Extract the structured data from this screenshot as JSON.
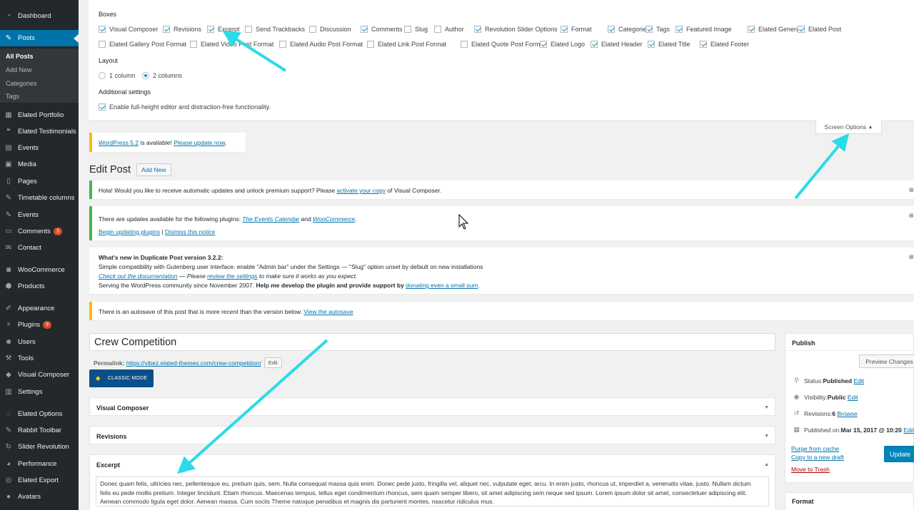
{
  "sidebar": {
    "items": [
      {
        "label": "Dashboard",
        "icon": "dashboard-icon",
        "glyph": "◔"
      },
      {
        "label": "Posts",
        "icon": "pushpin-icon",
        "glyph": "✎",
        "active": true
      },
      {
        "label": "Elated Portfolio",
        "icon": "grid-icon",
        "glyph": "▦"
      },
      {
        "label": "Elated Testimonials",
        "icon": "quote-icon",
        "glyph": "❝"
      },
      {
        "label": "Events",
        "icon": "calendar-icon",
        "glyph": "▤"
      },
      {
        "label": "Media",
        "icon": "media-icon",
        "glyph": "▣"
      },
      {
        "label": "Pages",
        "icon": "page-icon",
        "glyph": "▯"
      },
      {
        "label": "Timetable columns",
        "icon": "pushpin-icon",
        "glyph": "✎"
      },
      {
        "label": "Events",
        "icon": "pushpin-icon",
        "glyph": "✎"
      },
      {
        "label": "Comments",
        "icon": "comment-icon",
        "glyph": "▭",
        "badge": "3"
      },
      {
        "label": "Contact",
        "icon": "mail-icon",
        "glyph": "✉"
      },
      {
        "label": "WooCommerce",
        "icon": "woocommerce-icon",
        "glyph": "◙"
      },
      {
        "label": "Products",
        "icon": "archive-icon",
        "glyph": "⬢"
      },
      {
        "label": "Appearance",
        "icon": "brush-icon",
        "glyph": "✐"
      },
      {
        "label": "Plugins",
        "icon": "plug-icon",
        "glyph": "⚡",
        "badge": "9"
      },
      {
        "label": "Users",
        "icon": "users-icon",
        "glyph": "☻"
      },
      {
        "label": "Tools",
        "icon": "wrench-icon",
        "glyph": "⚒"
      },
      {
        "label": "Visual Composer",
        "icon": "visual-composer-icon",
        "glyph": "◆"
      },
      {
        "label": "Settings",
        "icon": "settings-icon",
        "glyph": "▥"
      },
      {
        "label": "Elated Options",
        "icon": "elated-icon",
        "glyph": "◌"
      },
      {
        "label": "Rabbit Toolbar",
        "icon": "rabbit-icon",
        "glyph": "✎"
      },
      {
        "label": "Slider Revolution",
        "icon": "refresh-icon",
        "glyph": "↻"
      },
      {
        "label": "Performance",
        "icon": "gauge-icon",
        "glyph": "◕"
      },
      {
        "label": "Elated Export",
        "icon": "export-icon",
        "glyph": "◎"
      },
      {
        "label": "Avatars",
        "icon": "avatar-icon",
        "glyph": "●"
      }
    ],
    "submenu": [
      "All Posts",
      "Add New",
      "Categories",
      "Tags"
    ]
  },
  "screen_options": {
    "boxes_heading": "Boxes",
    "boxes_row1": [
      {
        "label": "Visual Composer",
        "checked": true
      },
      {
        "label": "Revisions",
        "checked": true
      },
      {
        "label": "Excerpt",
        "checked": true
      },
      {
        "label": "Send Trackbacks",
        "checked": false
      },
      {
        "label": "Discussion",
        "checked": false
      },
      {
        "label": "Comments",
        "checked": true
      },
      {
        "label": "Slug",
        "checked": false
      },
      {
        "label": "Author",
        "checked": false
      },
      {
        "label": "Revolution Slider Options",
        "checked": true
      },
      {
        "label": "Format",
        "checked": true
      },
      {
        "label": "Categories",
        "checked": true
      },
      {
        "label": "Tags",
        "checked": true
      },
      {
        "label": "Featured Image",
        "checked": true
      },
      {
        "label": "Elated General",
        "checked": true
      },
      {
        "label": "Elated Post",
        "checked": true
      }
    ],
    "boxes_row2": [
      {
        "label": "Elated Gallery Post Format",
        "checked": false
      },
      {
        "label": "Elated Video Post Format",
        "checked": false
      },
      {
        "label": "Elated Audio Post Format",
        "checked": false
      },
      {
        "label": "Elated Link Post Format",
        "checked": false
      },
      {
        "label": "Elated Quote Post Format",
        "checked": false
      },
      {
        "label": "Elated Logo",
        "checked": true
      },
      {
        "label": "Elated Header",
        "checked": true
      },
      {
        "label": "Elated Title",
        "checked": true
      },
      {
        "label": "Elated Footer",
        "checked": true
      }
    ],
    "layout_heading": "Layout",
    "layout_options": [
      {
        "label": "1 column",
        "selected": false
      },
      {
        "label": "2 columns",
        "selected": true
      }
    ],
    "additional_heading": "Additional settings",
    "additional_option": {
      "label": "Enable full-height editor and distraction-free functionality.",
      "checked": true
    },
    "tab_label": "Screen Options",
    "tab_arrow": "▲"
  },
  "notices": {
    "wp_update": {
      "link1": "WordPress 5.2",
      "text": " is available! ",
      "link2": "Please update now",
      "end": "."
    },
    "vc": {
      "text1": "Hola! Would you like to receive automatic updates and unlock premium support? Please ",
      "link": "activate your copy",
      "text2": " of Visual Composer."
    },
    "plugins": {
      "text1": "There are updates available for the following plugins: ",
      "link1": "The Events Calendar",
      "and": " and ",
      "link2": "WooCommerce",
      "end": ".",
      "action1": "Begin updating plugins",
      "sep": " | ",
      "action2": "Dismiss this notice"
    },
    "duplicate": {
      "title": "What's new in Duplicate Post version 3.2.2:",
      "line1": "Simple compatibility with Gutenberg user interface: enable \"Admin bar\" under the Settings — \"Slug\" option unset by default on new installations",
      "doc_link": "Check out the documentation",
      "dash": " — Please ",
      "review_link": "review the settings",
      "review_end": " to make sure it works as you expect.",
      "line3a": "Serving the WordPress community since November 2007. ",
      "line3b": "Help me develop the plugin and provide support by ",
      "donate_link": "donating even a small sum",
      "line3c": "."
    },
    "autosave": {
      "text": "There is an autosave of this post that is more recent than the version below. ",
      "link": "View the autosave"
    },
    "dismiss_glyph": "⊗"
  },
  "editor": {
    "page_title": "Edit Post",
    "add_new": "Add New",
    "post_title": "Crew Competition",
    "permalink_label": "Permalink:",
    "permalink_url": "https://vibez.elated-themes.com/crew-competition/",
    "permalink_edit": "Edit",
    "classic_mode": "CLASSIC MODE",
    "boxes": {
      "visual_composer": "Visual Composer",
      "revisions": "Revisions",
      "excerpt": "Excerpt"
    },
    "collapse_glyph": "▼",
    "expand_glyph": "▲",
    "excerpt_text": "Donec quam felis, ultricies nec, pellentesque eu, pretium quis, sem. Nulla consequat massa quis enim. Donec pede justo, fringilla vel, aliquet nec, vulputate eget, arcu. In enim justo, rhoncus ut, imperdiet a, venenatis vitae, justo. Nullam dictum felis eu pede mollis pretium. Integer tincidunt. Etiam rhoncus. Maecenas tempus, tellus eget condimentum rhoncus, sem quam semper libero, sit amet adipiscing sem neque sed ipsum. Lorem ipsum dolor sit amet, consectetuer adipiscing elit. Aenean commodo ligula eget dolor. Aenean massa. Cum sociis Theme natoque penatibus et magnis dis parturient montes, nascetur ridiculus mus."
  },
  "publish": {
    "title": "Publish",
    "preview": "Preview Changes",
    "status_label": "Status: ",
    "status_value": "Published",
    "visibility_label": "Visibility: ",
    "visibility_value": "Public",
    "revisions_label": "Revisions: ",
    "revisions_value": "6",
    "revisions_link": "Browse",
    "published_label": "Published on: ",
    "published_value": "Mar 15, 2017 @ 10:20",
    "edit": "Edit",
    "purge": "Purge from cache",
    "copy": "Copy to a new draft",
    "trash": "Move to Trash",
    "update": "Update"
  },
  "format_box": {
    "title": "Format"
  },
  "colors": {
    "accent": "#0073aa",
    "sidebar": "#23282d",
    "annotation_arrow": "#2bdbe8"
  }
}
